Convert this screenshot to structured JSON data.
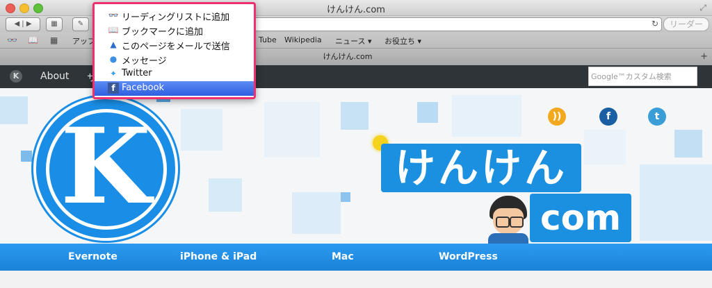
{
  "window": {
    "title": "けんけん.com"
  },
  "toolbar": {
    "reader_label": "リーダー"
  },
  "bookmarks": [
    "アップ",
    "Tube",
    "Wikipedia",
    "ニュース ▾",
    "お役立ち ▾"
  ],
  "tab": {
    "title": "けんけん.com"
  },
  "site_nav": {
    "items": [
      "About",
      "サ"
    ]
  },
  "search": {
    "placeholder": "Google™カスタム検索"
  },
  "share_menu": {
    "items": [
      {
        "label": "リーディングリストに追加",
        "icon": "reading-list-icon"
      },
      {
        "label": "ブックマークに追加",
        "icon": "book-icon"
      },
      {
        "label": "このページをメールで送信",
        "icon": "mail-stamp-icon"
      },
      {
        "label": "メッセージ",
        "icon": "message-bubble-icon"
      },
      {
        "label": "Twitter",
        "icon": "twitter-bird-icon"
      },
      {
        "label": "Facebook",
        "icon": "facebook-icon",
        "selected": true
      }
    ]
  },
  "header": {
    "brand_kana": "けんけん",
    "brand_com": "com",
    "logo_letter": "K"
  },
  "categories": [
    "Evernote",
    "iPhone & iPad",
    "Mac",
    "WordPress"
  ],
  "colors": {
    "nav_dark": "#2e3438",
    "brand_blue": "#1b8fe0",
    "menu_highlight": "#2e5fe0",
    "menu_border": "#f0306e"
  }
}
